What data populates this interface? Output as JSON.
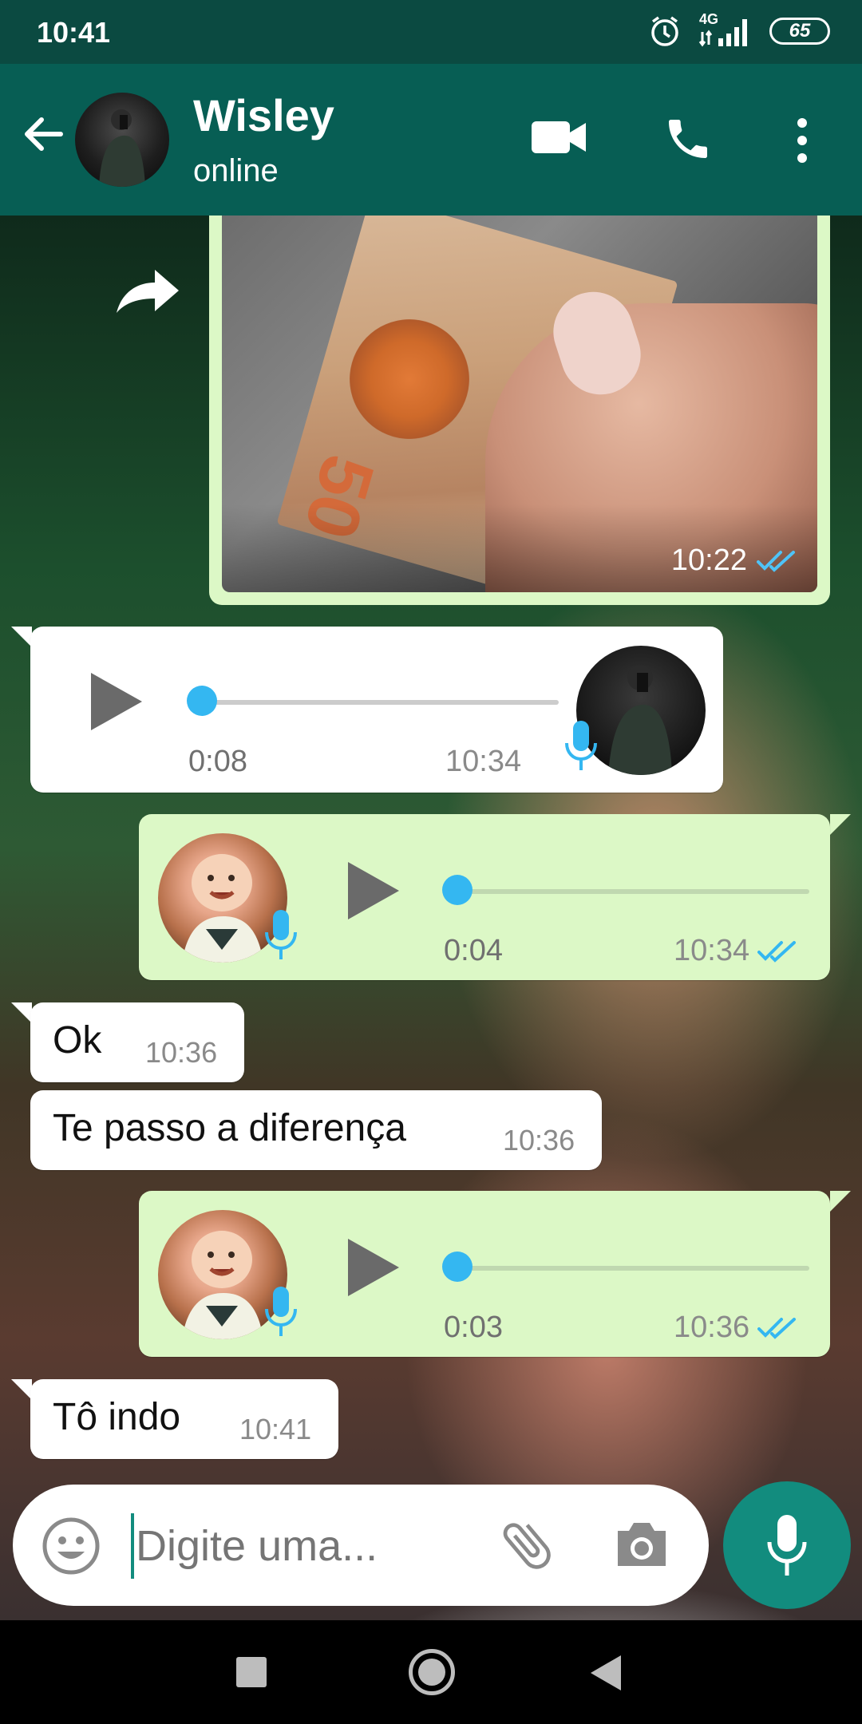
{
  "status_bar": {
    "time": "10:41",
    "network": "4G",
    "battery": "65"
  },
  "header": {
    "contact_name": "Wisley",
    "contact_status": "online"
  },
  "messages": {
    "photo": {
      "time": "10:22",
      "banknote_value": "50"
    },
    "audio_in": {
      "duration": "0:08",
      "time": "10:34"
    },
    "audio_out_1": {
      "duration": "0:04",
      "time": "10:34"
    },
    "text_1": {
      "text": "Ok",
      "time": "10:36"
    },
    "text_2": {
      "text": "Te passo a diferença",
      "time": "10:36"
    },
    "audio_out_2": {
      "duration": "0:03",
      "time": "10:36"
    },
    "text_3": {
      "text": "Tô indo",
      "time": "10:41"
    }
  },
  "input": {
    "placeholder": "Digite uma..."
  },
  "colors": {
    "header": "#075e54",
    "status_bar": "#0b4a41",
    "outgoing_bubble": "#dcf8c6",
    "incoming_bubble": "#ffffff",
    "accent_blue": "#34b7f1",
    "fab": "#128c7e"
  },
  "icons": [
    "back-arrow-icon",
    "video-camera-icon",
    "phone-icon",
    "more-vert-icon",
    "forward-icon",
    "play-icon",
    "mic-icon",
    "double-check-icon",
    "emoji-icon",
    "paperclip-icon",
    "camera-icon",
    "nav-square-icon",
    "nav-home-icon",
    "nav-back-icon"
  ]
}
